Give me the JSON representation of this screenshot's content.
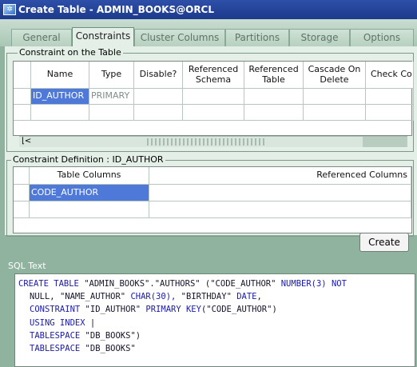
{
  "window": {
    "title": "Create Table - ADMIN_BOOKS@ORCL"
  },
  "tabs": [
    {
      "label": "General",
      "active": false
    },
    {
      "label": "Constraints",
      "active": true
    },
    {
      "label": "Cluster Columns",
      "active": false
    },
    {
      "label": "Partitions",
      "active": false
    },
    {
      "label": "Storage",
      "active": false
    },
    {
      "label": "Options",
      "active": false
    }
  ],
  "constraints": {
    "group_label": "Constraint on the Table",
    "columns": [
      "Name",
      "Type",
      "Disable?",
      "Referenced Schema",
      "Referenced Table",
      "Cascade On Delete",
      "Check Co"
    ],
    "rows": [
      {
        "name": "ID_AUTHOR",
        "type": "PRIMARY"
      }
    ],
    "scroll_left_glyph": "⌊<"
  },
  "definition": {
    "group_label": "Constraint Definition : ID_AUTHOR",
    "columns": [
      "Table Columns",
      "Referenced Columns"
    ],
    "rows": [
      {
        "table_column": "CODE_AUTHOR",
        "referenced_column": ""
      }
    ]
  },
  "create_button": {
    "label": "Create"
  },
  "sql": {
    "label": "SQL Text",
    "lines": [
      [
        "CREATE TABLE ",
        "kw",
        "\"ADMIN_BOOKS\".\"AUTHORS\" (\"CODE_AUTHOR\" ",
        "",
        "NUMBER(3) NOT",
        "kw"
      ],
      [
        "NULL, ",
        "",
        "\"NAME_AUTHOR\" ",
        "",
        "CHAR(30), ",
        "kw",
        "\"BIRTHDAY\" ",
        "",
        "DATE",
        "kw",
        ",",
        ""
      ],
      [
        "CONSTRAINT ",
        "kw",
        "\"ID_AUTHOR\" ",
        "",
        "PRIMARY KEY",
        "kw",
        "(\"CODE_AUTHOR\")",
        ""
      ],
      [
        "USING INDEX",
        "kw",
        " |",
        ""
      ],
      [
        "TABLESPACE ",
        "kw",
        "\"DB_BOOKS\")",
        ""
      ],
      [
        "TABLESPACE ",
        "kw",
        "\"DB_BOOKS\"",
        ""
      ]
    ]
  }
}
